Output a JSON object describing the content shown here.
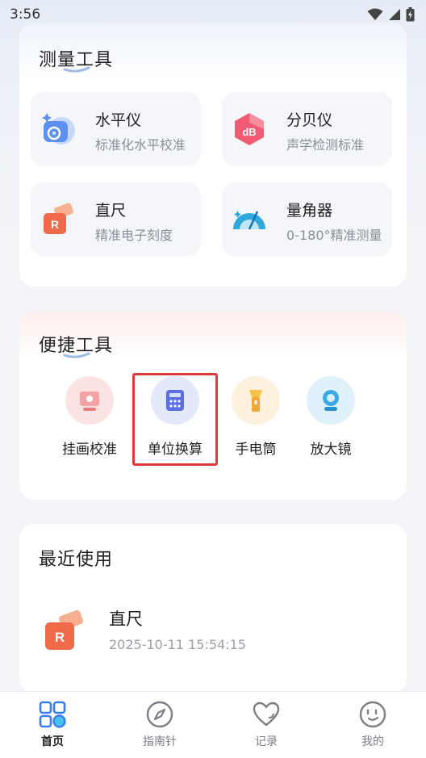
{
  "status": {
    "time": "3:56"
  },
  "measure_section": {
    "title": "测量工具",
    "tools": [
      {
        "name": "水平仪",
        "desc": "标准化水平校准",
        "icon": "level-icon"
      },
      {
        "name": "分贝仪",
        "desc": "声学检测标准",
        "icon": "decibel-icon",
        "icon_text": "dB"
      },
      {
        "name": "直尺",
        "desc": "精准电子刻度",
        "icon": "ruler-icon",
        "icon_text": "R"
      },
      {
        "name": "量角器",
        "desc": "0-180°精准测量",
        "icon": "protractor-icon"
      }
    ]
  },
  "quick_section": {
    "title": "便捷工具",
    "items": [
      {
        "label": "挂画校准",
        "icon": "picture-align-icon"
      },
      {
        "label": "单位换算",
        "icon": "calculator-icon"
      },
      {
        "label": "手电筒",
        "icon": "flashlight-icon"
      },
      {
        "label": "放大镜",
        "icon": "magnifier-icon"
      }
    ]
  },
  "recent_section": {
    "title": "最近使用",
    "items": [
      {
        "name": "直尺",
        "time": "2025-10-11 15:54:15",
        "icon": "ruler-icon",
        "icon_text": "R"
      }
    ]
  },
  "bottom_nav": {
    "items": [
      {
        "label": "首页",
        "icon": "home-grid-icon",
        "active": true
      },
      {
        "label": "指南针",
        "icon": "compass-icon",
        "active": false
      },
      {
        "label": "记录",
        "icon": "heart-icon",
        "active": false
      },
      {
        "label": "我的",
        "icon": "profile-smile-icon",
        "active": false
      }
    ]
  },
  "colors": {
    "accent_blue": "#3a7bf0",
    "highlight_red": "#e0393b",
    "ruler_orange": "#f06a4a",
    "decibel_pink": "#ef4f6a"
  }
}
